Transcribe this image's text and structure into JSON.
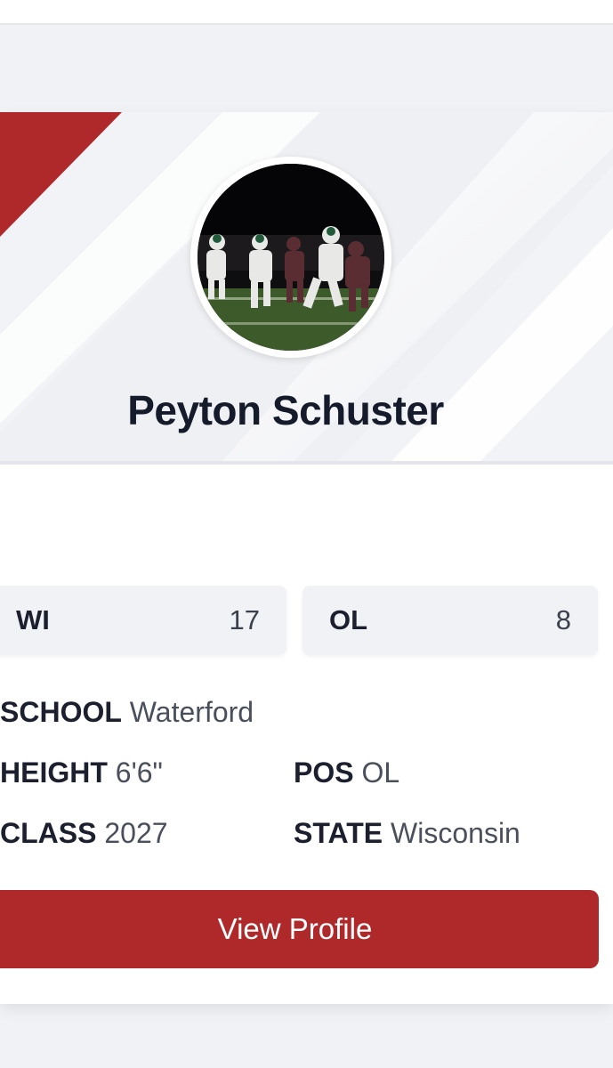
{
  "player": {
    "name": "Peyton Schuster"
  },
  "stats": [
    {
      "label": "WI",
      "value": "17"
    },
    {
      "label": "OL",
      "value": "8"
    }
  ],
  "details": {
    "school_label": "SCHOOL",
    "school_value": "Waterford",
    "height_label": "HEIGHT",
    "height_value": "6'6\"",
    "pos_label": "POS",
    "pos_value": "OL",
    "class_label": "CLASS",
    "class_value": "2027",
    "state_label": "STATE",
    "state_value": "Wisconsin"
  },
  "actions": {
    "view_profile_label": "View Profile"
  },
  "colors": {
    "accent": "#b0292a",
    "background": "#f1f2f5",
    "card": "#ffffff"
  }
}
